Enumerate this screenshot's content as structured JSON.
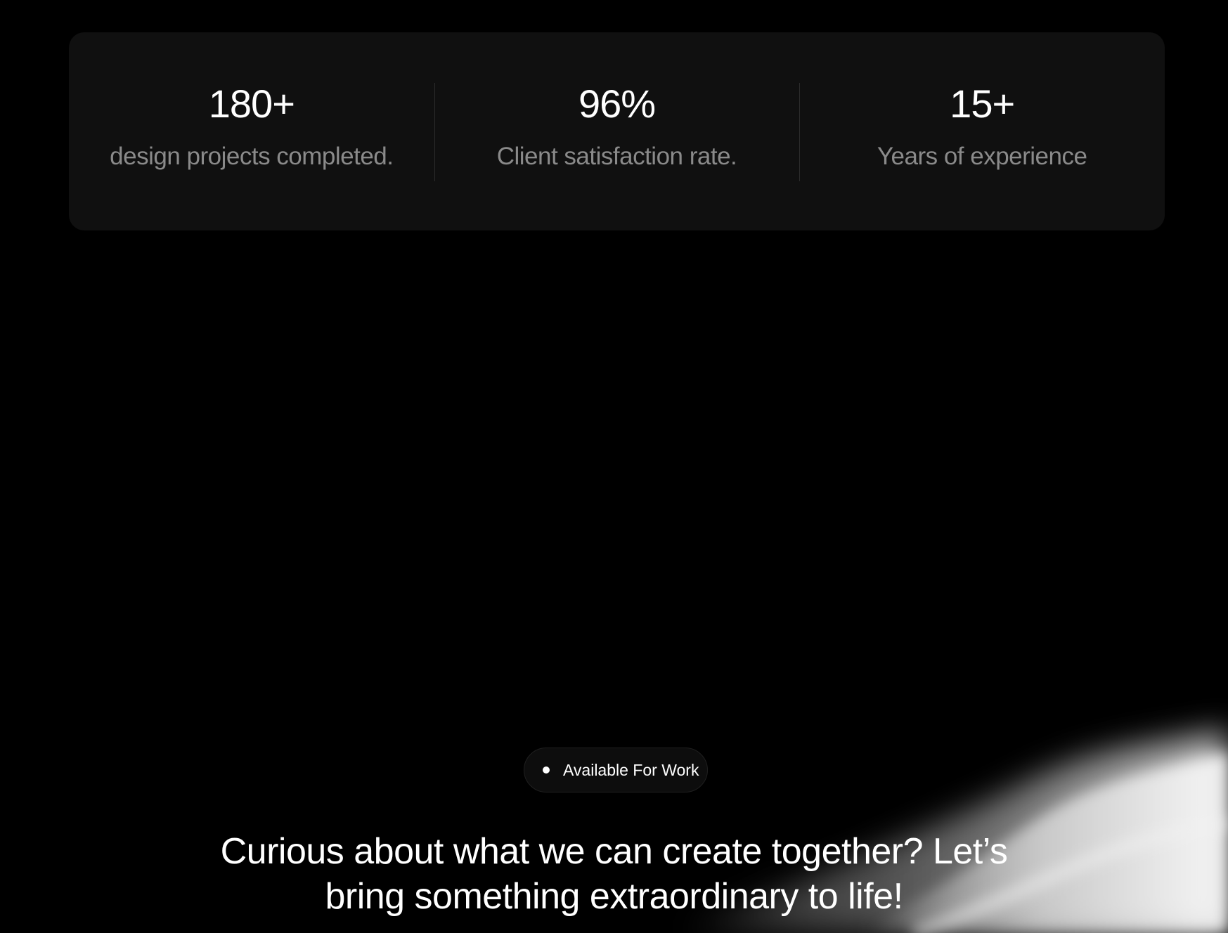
{
  "stats": [
    {
      "value": "180+",
      "label": "design projects completed."
    },
    {
      "value": "96%",
      "label": "Client satisfaction rate."
    },
    {
      "value": "15+",
      "label": "Years of experience"
    }
  ],
  "badge": {
    "label": "Available For Work",
    "icon": "status-dot-icon"
  },
  "cta": {
    "line1": "Curious about what we can create together? Let’s",
    "line2": "bring something extraordinary to life!"
  },
  "colors": {
    "background": "#000000",
    "card": "#101010",
    "label": "#8a8a8a",
    "text": "#ffffff"
  }
}
